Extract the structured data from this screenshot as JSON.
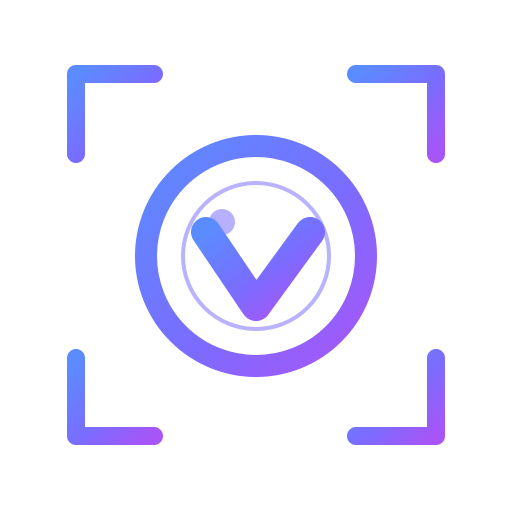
{
  "app_icon": {
    "icon_name": "scan-viewfinder-v-logo-icon",
    "colors": {
      "gradient_start": "#5b8cff",
      "gradient_mid": "#7a6cff",
      "gradient_end": "#a855f7",
      "inner_ring": "#b8b2ff",
      "dot": "#b7b0ff",
      "background": "#ffffff"
    }
  }
}
